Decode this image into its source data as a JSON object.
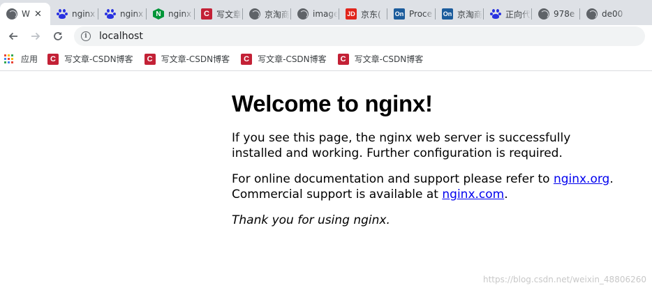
{
  "browser": {
    "tabs": [
      {
        "title": "W",
        "favicon": "globe-icon",
        "active": true
      },
      {
        "title": "nginx",
        "favicon": "baidu-paw-icon"
      },
      {
        "title": "nginx",
        "favicon": "baidu-paw-icon"
      },
      {
        "title": "nginx",
        "favicon": "nginx-icon",
        "glyph": "N"
      },
      {
        "title": "写文章",
        "favicon": "csdn-icon",
        "glyph": "C"
      },
      {
        "title": "京淘商",
        "favicon": "globe-icon"
      },
      {
        "title": "image",
        "favicon": "globe-icon"
      },
      {
        "title": "京东(",
        "favicon": "jd-icon",
        "glyph": "JD"
      },
      {
        "title": "Proce",
        "favicon": "on-icon",
        "glyph": "On"
      },
      {
        "title": "京淘商",
        "favicon": "on-icon",
        "glyph": "On"
      },
      {
        "title": "正向代",
        "favicon": "baidu-paw-icon"
      },
      {
        "title": "978e",
        "favicon": "globe-icon"
      },
      {
        "title": "de00",
        "favicon": "globe-icon"
      }
    ],
    "close_glyph": "✕",
    "address": {
      "url": "localhost",
      "info_glyph": "i"
    },
    "bookmarks": {
      "apps_label": "应用",
      "items": [
        {
          "label": "写文章-CSDN博客",
          "glyph": "C"
        },
        {
          "label": "写文章-CSDN博客",
          "glyph": "C"
        },
        {
          "label": "写文章-CSDN博客",
          "glyph": "C"
        },
        {
          "label": "写文章-CSDN博客",
          "glyph": "C"
        }
      ]
    }
  },
  "page": {
    "heading": "Welcome to nginx!",
    "para1": "If you see this page, the nginx web server is successfully installed and working. Further configuration is required.",
    "para2": {
      "prefix": "For online documentation and support please refer to ",
      "link1": "nginx.org",
      "middle": ". Commercial support is available at ",
      "link2": "nginx.com",
      "suffix": "."
    },
    "thanks": "Thank you for using nginx.",
    "watermark": "https://blog.csdn.net/weixin_48806260"
  },
  "colors": {
    "tabstrip": "#dee1e6",
    "link": "#0000ee",
    "csdn": "#c32136",
    "nginx": "#009639",
    "baidu": "#2932e1",
    "jd": "#e1251b",
    "on": "#1c5c9c"
  }
}
